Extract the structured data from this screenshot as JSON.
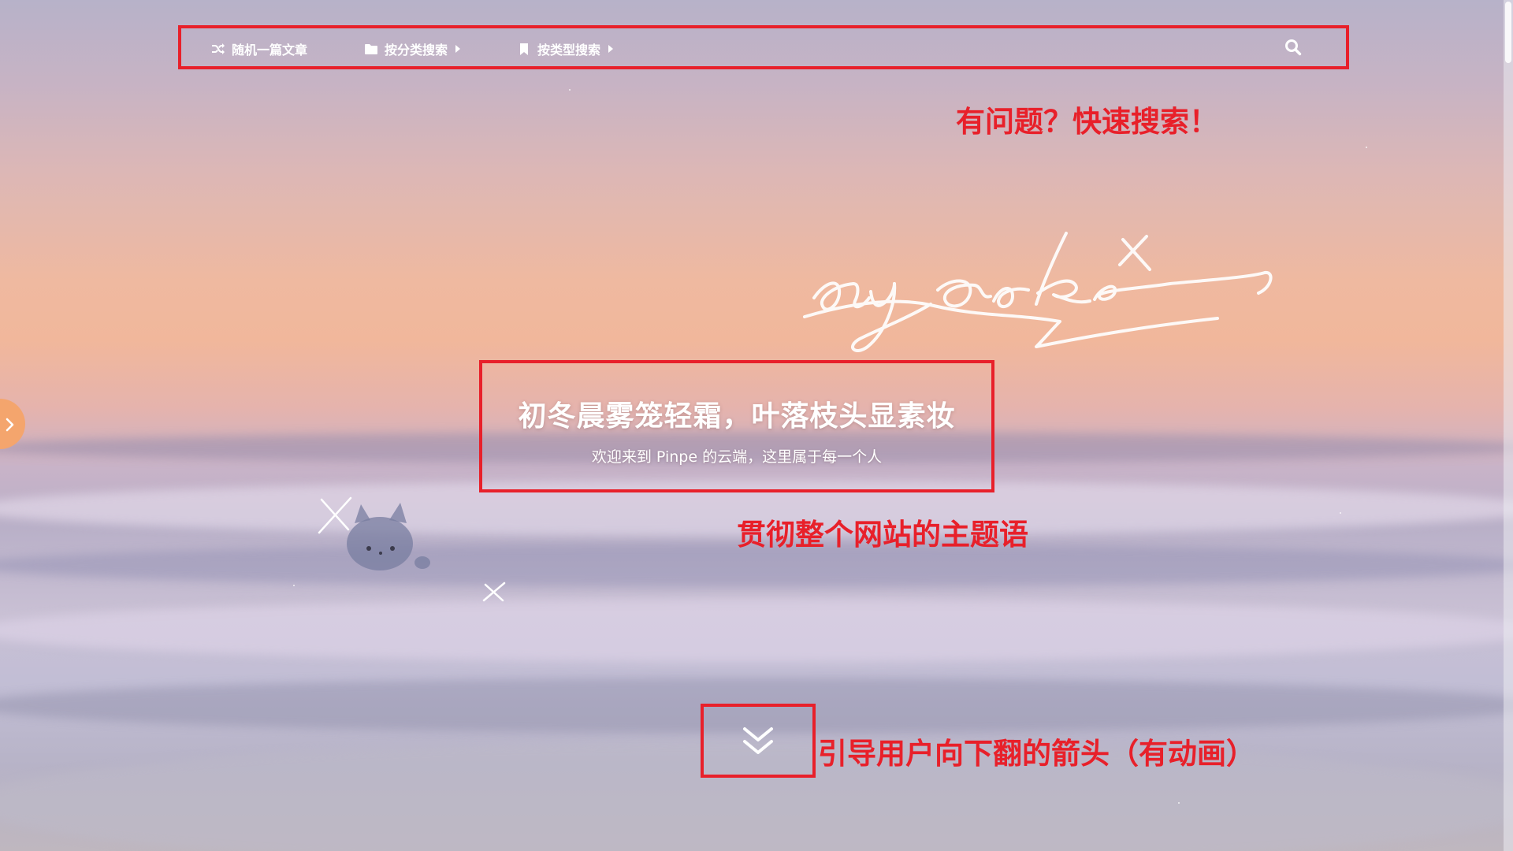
{
  "nav": {
    "items": [
      {
        "label": "随机一篇文章",
        "icon": "shuffle-icon",
        "has_caret": false
      },
      {
        "label": "按分类搜索",
        "icon": "folder-icon",
        "has_caret": true
      },
      {
        "label": "按类型搜索",
        "icon": "bookmark-icon",
        "has_caret": true
      }
    ],
    "search_icon": "search-icon"
  },
  "hero": {
    "title": "初冬晨雾笼轻霜，叶落枝头显素妆",
    "subtitle": "欢迎来到 Pinpe 的云端，这里属于每一个人"
  },
  "annotations": {
    "search": "有问题？快速搜索！",
    "motto": "贯彻整个网站的主题语",
    "arrow": "引导用户向下翻的箭头（有动画）"
  },
  "down_arrow_icon": "double-chevron-down-icon",
  "sidebar_toggle_icon": "chevron-right-icon",
  "colors": {
    "annotation_red": "#e8202a",
    "toggle_orange": "#f4a56d",
    "nav_text": "#ffffff"
  }
}
